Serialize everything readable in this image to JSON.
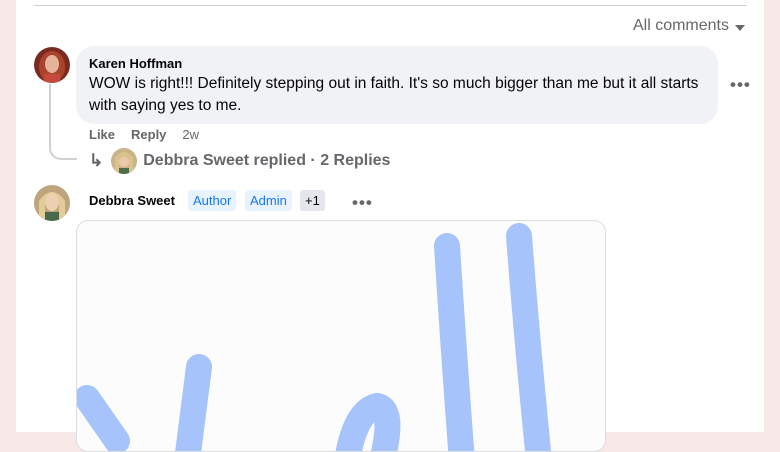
{
  "sort": {
    "label": "All comments",
    "icon": "caret-down-icon"
  },
  "comment": {
    "author": "Karen Hoffman",
    "text": "WOW is right!!! Definitely stepping out in faith. It's so much bigger than me but it all starts with saying yes to me.",
    "more": "•••",
    "actions": {
      "like": "Like",
      "reply": "Reply",
      "time": "2w"
    }
  },
  "replies_link": {
    "arrow": "↳",
    "text": "Debbra Sweet replied · 2 Replies"
  },
  "post": {
    "author": "Debbra Sweet",
    "badges": [
      "Author",
      "Admin",
      "+1"
    ],
    "more": "•••",
    "drawing_color": "#a6c4fb"
  }
}
